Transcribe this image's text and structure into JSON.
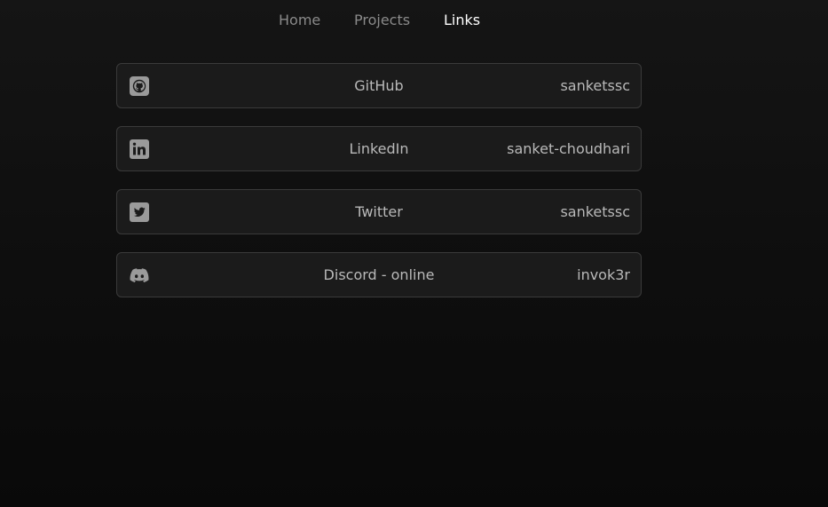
{
  "nav": {
    "items": [
      {
        "label": "Home",
        "active": false
      },
      {
        "label": "Projects",
        "active": false
      },
      {
        "label": "Links",
        "active": true
      }
    ]
  },
  "links": [
    {
      "icon": "github-icon",
      "name": "GitHub",
      "handle": "sanketssc"
    },
    {
      "icon": "linkedin-icon",
      "name": "LinkedIn",
      "handle": "sanket-choudhari"
    },
    {
      "icon": "twitter-icon",
      "name": "Twitter",
      "handle": "sanketssc"
    },
    {
      "icon": "discord-icon",
      "name": "Discord - online",
      "handle": "invok3r"
    }
  ],
  "colors": {
    "background": "#0f0f0f",
    "card_background": "#1b1b1b",
    "card_border": "#3a3a3a",
    "text": "#b9b9b9",
    "nav_inactive": "#8a8a8a",
    "nav_active": "#ffffff",
    "icon": "#9a9a9a"
  }
}
